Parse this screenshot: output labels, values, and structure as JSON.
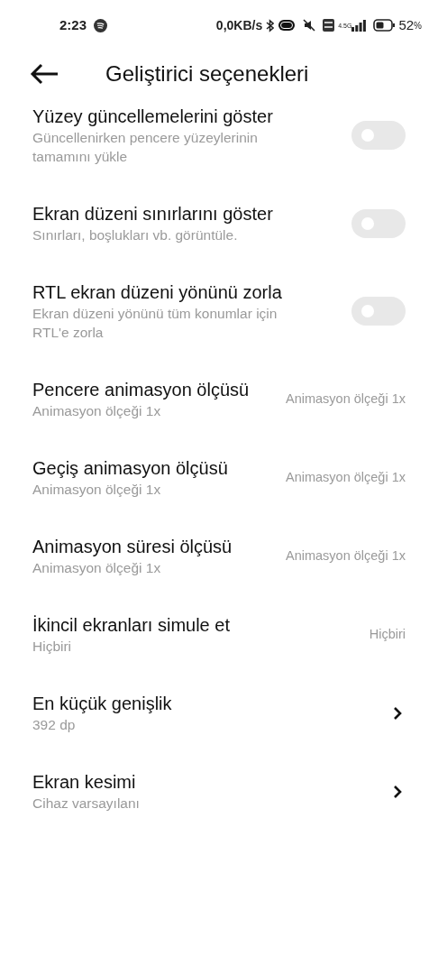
{
  "status_bar": {
    "time": "2:23",
    "speed": "0,0KB/s",
    "network": "4.5G",
    "battery": "52",
    "battery_unit": "%"
  },
  "header": {
    "title": "Geliştirici seçenekleri"
  },
  "settings": [
    {
      "kind": "switch",
      "title": "Yüzey güncellemelerini göster",
      "subtitle": "Güncellenirken pencere yüzeylerinin tamamını yükle",
      "on": false
    },
    {
      "kind": "switch",
      "title": "Ekran düzeni sınırlarını göster",
      "subtitle": "Sınırları, boşlukları vb. görüntüle.",
      "on": false
    },
    {
      "kind": "switch",
      "title": "RTL ekran düzeni yönünü zorla",
      "subtitle": "Ekran düzeni yönünü tüm konumlar için RTL'e zorla",
      "on": false
    },
    {
      "kind": "value",
      "title": "Pencere animasyon ölçüsü",
      "subtitle": "Animasyon ölçeği 1x",
      "value": "Animasyon ölçeği 1x"
    },
    {
      "kind": "value",
      "title": "Geçiş animasyon ölçüsü",
      "subtitle": "Animasyon ölçeği 1x",
      "value": "Animasyon ölçeği 1x"
    },
    {
      "kind": "value",
      "title": "Animasyon süresi ölçüsü",
      "subtitle": "Animasyon ölçeği 1x",
      "value": "Animasyon ölçeği 1x"
    },
    {
      "kind": "value",
      "title": "İkincil ekranları simule et",
      "subtitle": "Hiçbiri",
      "value": "Hiçbiri"
    },
    {
      "kind": "arrow",
      "title": "En küçük genişlik",
      "subtitle": "392 dp"
    },
    {
      "kind": "arrow",
      "title": "Ekran kesimi",
      "subtitle": "Cihaz varsayılanı"
    }
  ]
}
